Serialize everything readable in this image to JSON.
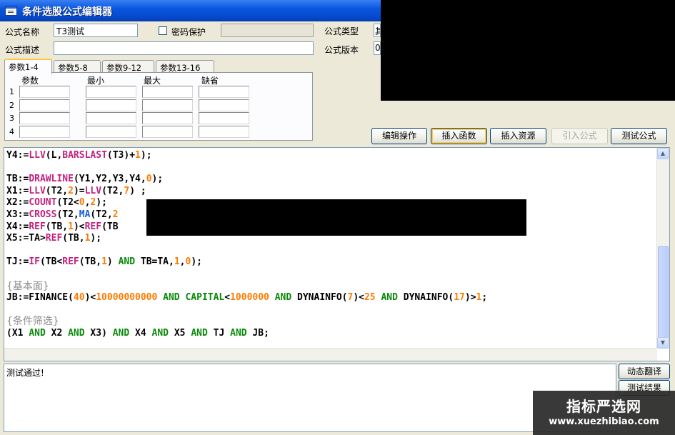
{
  "window": {
    "title": "条件选股公式编辑器",
    "icon": "window-app-icon"
  },
  "form": {
    "name_label": "公式名称",
    "name_value": "T3测试",
    "password_label": "密码保护",
    "password_checked": false,
    "type_label": "公式类型",
    "type_value_partial": "其",
    "desc_label": "公式描述",
    "desc_value": "",
    "version_label": "公式版本",
    "version_value_partial": "0"
  },
  "tabs": [
    {
      "label": "参数1-4",
      "active": true
    },
    {
      "label": "参数5-8",
      "active": false
    },
    {
      "label": "参数9-12",
      "active": false
    },
    {
      "label": "参数13-16",
      "active": false
    }
  ],
  "params": {
    "headers": [
      "参数",
      "最小",
      "最大",
      "缺省"
    ],
    "rows": [
      "1",
      "2",
      "3",
      "4"
    ]
  },
  "buttons": {
    "edit_ops": "编辑操作",
    "insert_func": "插入函数",
    "insert_resource": "插入资源",
    "import_formula": "引入公式",
    "test_formula": "测试公式"
  },
  "code_lines": [
    [
      [
        "Y4:=",
        ""
      ],
      [
        "LLV",
        "fn"
      ],
      [
        "(L,",
        ""
      ],
      [
        "BARSLAST",
        "fn"
      ],
      [
        "(T3)+",
        ""
      ],
      [
        "1",
        "num"
      ],
      [
        ");",
        ""
      ]
    ],
    [],
    [
      [
        "TB:=",
        ""
      ],
      [
        "DRAWLINE",
        "fn"
      ],
      [
        "(Y1,Y2,Y3,Y4,",
        ""
      ],
      [
        "0",
        "num"
      ],
      [
        ");",
        ""
      ]
    ],
    [
      [
        "X1:=",
        ""
      ],
      [
        "LLV",
        "fn"
      ],
      [
        "(T2,",
        ""
      ],
      [
        "2",
        "num"
      ],
      [
        ")=",
        ""
      ],
      [
        "LLV",
        "fn"
      ],
      [
        "(T2,",
        ""
      ],
      [
        "7",
        "num"
      ],
      [
        ") ;",
        ""
      ]
    ],
    [
      [
        "X2:=",
        ""
      ],
      [
        "COUNT",
        "fn"
      ],
      [
        "(T2<",
        ""
      ],
      [
        "0",
        "num"
      ],
      [
        ",",
        ""
      ],
      [
        "2",
        "num"
      ],
      [
        ");",
        ""
      ]
    ],
    [
      [
        "X3:=",
        ""
      ],
      [
        "CROSS",
        "fn"
      ],
      [
        "(T2,",
        ""
      ],
      [
        "MA",
        "ma"
      ],
      [
        "(T2,",
        ""
      ],
      [
        "2",
        "num"
      ]
    ],
    [
      [
        "X4:=",
        ""
      ],
      [
        "REF",
        "fn"
      ],
      [
        "(TB,",
        ""
      ],
      [
        "1",
        "num"
      ],
      [
        ")<",
        ""
      ],
      [
        "REF",
        "fn"
      ],
      [
        "(TB",
        ""
      ]
    ],
    [
      [
        "X5:=TA>",
        ""
      ],
      [
        "REF",
        "fn"
      ],
      [
        "(TB,",
        ""
      ],
      [
        "1",
        "num"
      ],
      [
        ");",
        ""
      ]
    ],
    [],
    [
      [
        "TJ:=",
        ""
      ],
      [
        "IF",
        "fn"
      ],
      [
        "(TB<",
        ""
      ],
      [
        "REF",
        "fn"
      ],
      [
        "(TB,",
        ""
      ],
      [
        "1",
        "num"
      ],
      [
        ") ",
        ""
      ],
      [
        "AND",
        "kw"
      ],
      [
        " TB=TA,",
        ""
      ],
      [
        "1",
        "num"
      ],
      [
        ",",
        ""
      ],
      [
        "0",
        "num"
      ],
      [
        ");",
        ""
      ]
    ],
    [],
    {
      "comment": "{基本面}"
    },
    [
      [
        "JB:=FINANCE(",
        ""
      ],
      [
        "40",
        "num"
      ],
      [
        ")<",
        ""
      ],
      [
        "10000000000",
        "num"
      ],
      [
        " ",
        ""
      ],
      [
        "AND",
        "kw"
      ],
      [
        " ",
        ""
      ],
      [
        "CAPITAL",
        "kw2"
      ],
      [
        "<",
        ""
      ],
      [
        "1000000",
        "num"
      ],
      [
        " ",
        ""
      ],
      [
        "AND",
        "kw"
      ],
      [
        " DYNAINFO(",
        ""
      ],
      [
        "7",
        "num"
      ],
      [
        ")<",
        ""
      ],
      [
        "25",
        "num"
      ],
      [
        " ",
        ""
      ],
      [
        "AND",
        "kw"
      ],
      [
        " DYNAINFO(",
        ""
      ],
      [
        "17",
        "num"
      ],
      [
        ")>",
        ""
      ],
      [
        "1",
        "num"
      ],
      [
        ";",
        ""
      ]
    ],
    [],
    {
      "comment": "{条件筛选}"
    },
    [
      [
        "(X1 ",
        ""
      ],
      [
        "AND",
        "kw"
      ],
      [
        " X2 ",
        ""
      ],
      [
        "AND",
        "kw"
      ],
      [
        " X3) ",
        ""
      ],
      [
        "AND",
        "kw"
      ],
      [
        " X4 ",
        ""
      ],
      [
        "AND",
        "kw"
      ],
      [
        " X5 ",
        ""
      ],
      [
        "AND",
        "kw"
      ],
      [
        " TJ ",
        ""
      ],
      [
        "AND",
        "kw"
      ],
      [
        " JB;",
        ""
      ]
    ]
  ],
  "output": {
    "text": "测试通过!",
    "dynamic_translate": "动态翻译",
    "test_result": "测试结果"
  },
  "watermark": {
    "line1": "指标严选网",
    "line2": "www.xuezhibiao.com"
  },
  "colors": {
    "titlebar": "#0a57e0",
    "function": "#c4207e",
    "number": "#ff7a00",
    "keyword": "#0a8a0a",
    "ma": "#1c5bd8",
    "comment": "#8c8c8c"
  }
}
